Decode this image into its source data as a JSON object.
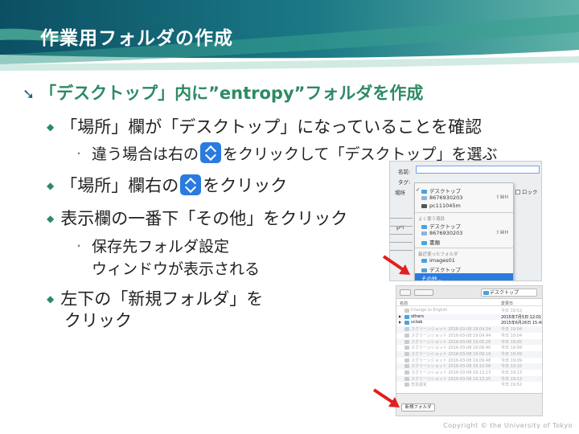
{
  "slide": {
    "title": "作業用フォルダの作成",
    "copyright": "Copyright © the University of Tokyo"
  },
  "bullets": {
    "main": "「デスクトップ」内に”entropy”フォルダを作成",
    "b1": "「場所」欄が「デスクトップ」になっていることを確認",
    "b1_sub_before": "違う場合は右の",
    "b1_sub_after": "をクリックして「デスクトップ」を選ぶ",
    "b2_before": "「場所」欄右の",
    "b2_after": "をクリック",
    "b3": "表示欄の一番下「その他」をクリック",
    "b3_sub_line1": "保存先フォルダ設定",
    "b3_sub_line2": "ウィンドウが表示される",
    "b4_line1": "左下の「新規フォルダ」を",
    "b4_line2": "クリック"
  },
  "save_dialog": {
    "name_label": "名前:",
    "tag_label": "タグ:",
    "location_label": "場所",
    "lock_label": "ロック",
    "bg_text": "p*i",
    "menu": {
      "item1": "デスクトップ",
      "item2": "8676930203",
      "item2_shortcut": "⇧⌘H",
      "item3": "pc111045m",
      "group_recent": "よく使う項目",
      "fav1": "デスクトップ",
      "fav2": "8676930203",
      "fav2_shortcut": "⇧⌘H",
      "fav3": "書類",
      "group_folders": "最近使ったフォルダ",
      "rec1": "images01",
      "rec2": "デスクトップ",
      "other": "その他..."
    }
  },
  "finder": {
    "location": "デスクトップ",
    "col_name": "名前",
    "col_date": "変更日",
    "new_folder": "新規フォルダ",
    "rows": [
      {
        "name": "Change to English",
        "date": "今日 19:52"
      },
      {
        "name": "others",
        "date": "2015年7月5日 12:01"
      },
      {
        "name": "scilab",
        "date": "2015年6月26日 15:48"
      },
      {
        "name": "スクリーンショット 2016-03-08 19.04.34",
        "date": "今日 19:04"
      },
      {
        "name": "スクリーンショット 2016-03-08 19.04.44",
        "date": "今日 19:04"
      },
      {
        "name": "スクリーンショット 2016-03-08 19.05.26",
        "date": "今日 19:05"
      },
      {
        "name": "スクリーンショット 2016-03-08 19.08.40",
        "date": "今日 19:08"
      },
      {
        "name": "スクリーンショット 2016-03-08 19.09.19",
        "date": "今日 19:09"
      },
      {
        "name": "スクリーンショット 2016-03-08 19.09.48",
        "date": "今日 19:09"
      },
      {
        "name": "スクリーンショット 2016-03-08 19.10.08",
        "date": "今日 19:10"
      },
      {
        "name": "スクリーンショット 2016-03-08 19.13.13",
        "date": "今日 19:13"
      },
      {
        "name": "スクリーンショット 2016-03-08 19.13.25",
        "date": "今日 19:13"
      },
      {
        "name": "日本語化",
        "date": "今日 19:52"
      }
    ]
  },
  "colors": {
    "header_dark": "#0f5a6e",
    "accent_green": "#2d8a64",
    "arrow_red": "#e02020",
    "select_blue": "#2a7be0"
  }
}
